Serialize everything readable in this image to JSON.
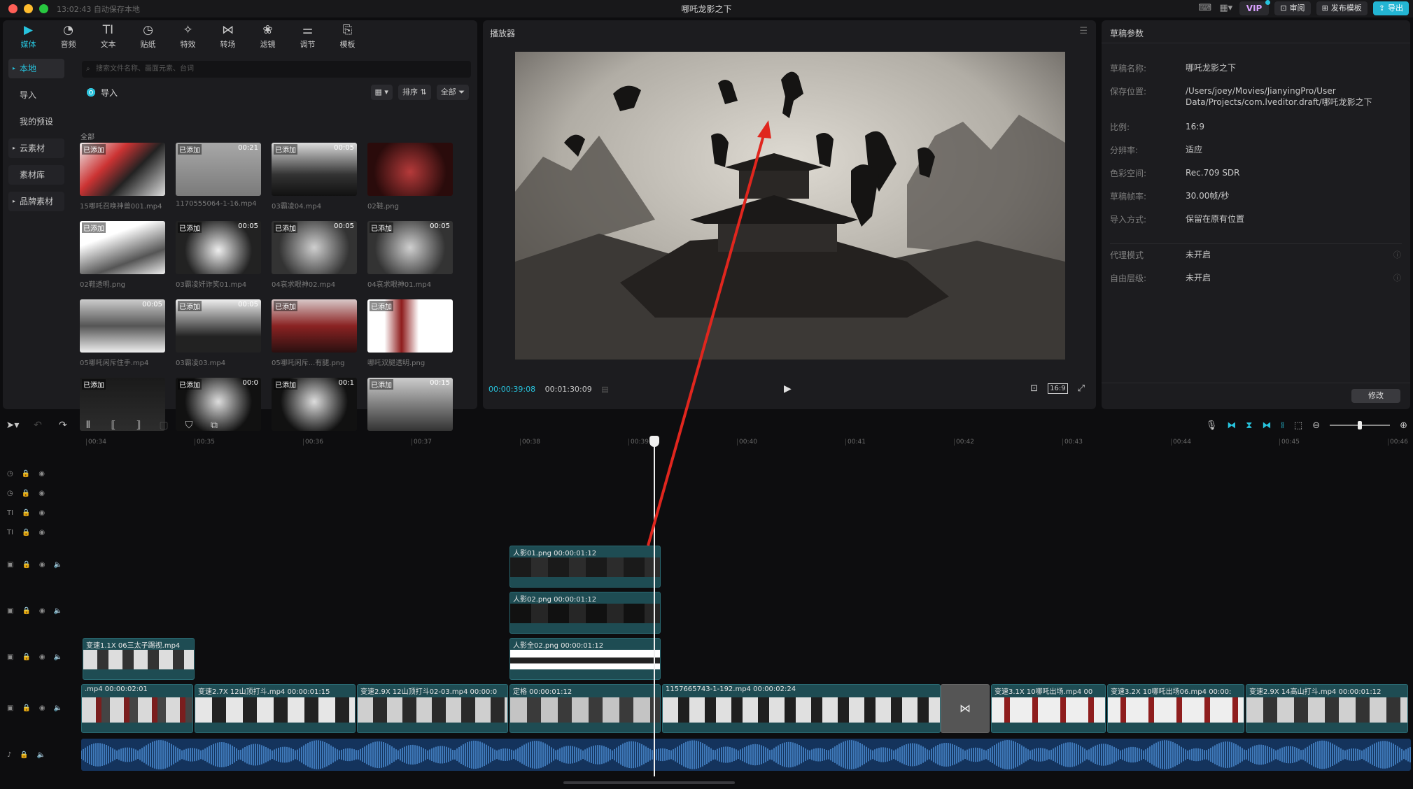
{
  "titlebar": {
    "autosave": "13:02:43 自动保存本地",
    "title": "哪吒龙影之下",
    "vip": "VIP",
    "review": "审阅",
    "publish": "发布模板",
    "export": "导出"
  },
  "tools": [
    {
      "label": "媒体",
      "icon": "media-icon",
      "active": true
    },
    {
      "label": "音频",
      "icon": "audio-icon"
    },
    {
      "label": "文本",
      "icon": "text-icon"
    },
    {
      "label": "贴纸",
      "icon": "sticker-icon"
    },
    {
      "label": "特效",
      "icon": "effects-icon"
    },
    {
      "label": "转场",
      "icon": "transition-icon"
    },
    {
      "label": "滤镜",
      "icon": "filter-icon"
    },
    {
      "label": "调节",
      "icon": "adjust-icon"
    },
    {
      "label": "模板",
      "icon": "template-icon"
    }
  ],
  "sidebar": {
    "items": [
      {
        "label": "本地",
        "active": true,
        "caret": true
      },
      {
        "label": "导入"
      },
      {
        "label": "我的预设"
      },
      {
        "label": "云素材",
        "caret": true,
        "box": true
      },
      {
        "label": "素材库",
        "box": true
      },
      {
        "label": "品牌素材",
        "caret": true,
        "box": true
      }
    ]
  },
  "media": {
    "search_placeholder": "搜索文件名称、画面元素、台词",
    "import_label": "导入",
    "sort_label": "排序",
    "all_filter": "全部",
    "section_label": "全部",
    "items": [
      {
        "name": "15哪吒召唤神兽001.mp4",
        "badge": "已添加",
        "duration": ""
      },
      {
        "name": "1170555064-1-16.mp4",
        "badge": "已添加",
        "duration": "00:21"
      },
      {
        "name": "03霸凌04.mp4",
        "badge": "已添加",
        "duration": "00:05"
      },
      {
        "name": "02鞋.png",
        "badge": "",
        "duration": ""
      },
      {
        "name": "02鞋透明.png",
        "badge": "已添加",
        "duration": ""
      },
      {
        "name": "03霸凌奸诈笑01.mp4",
        "badge": "已添加",
        "duration": "00:05"
      },
      {
        "name": "04哀求眼神02.mp4",
        "badge": "已添加",
        "duration": "00:05"
      },
      {
        "name": "04哀求眼神01.mp4",
        "badge": "已添加",
        "duration": "00:05"
      },
      {
        "name": "05哪吒闲斥住手.mp4",
        "badge": "",
        "duration": "00:05"
      },
      {
        "name": "03霸凌03.mp4",
        "badge": "已添加",
        "duration": "00:05"
      },
      {
        "name": "05哪吒闲斥...有腿.png",
        "badge": "已添加",
        "duration": ""
      },
      {
        "name": "哪吒双腿透明.png",
        "badge": "已添加",
        "duration": ""
      },
      {
        "name": "",
        "badge": "已添加",
        "duration": ""
      },
      {
        "name": "",
        "badge": "已添加",
        "duration": "00:0"
      },
      {
        "name": "",
        "badge": "已添加",
        "duration": "00:1"
      },
      {
        "name": "",
        "badge": "已添加",
        "duration": "00:15"
      }
    ]
  },
  "player": {
    "title": "播放器",
    "current_time": "00:00:39:08",
    "total_time": "00:01:30:09",
    "ratio": "16:9"
  },
  "properties": {
    "title": "草稿参数",
    "rows": [
      {
        "key": "草稿名称:",
        "value": "哪吒龙影之下"
      },
      {
        "key": "保存位置:",
        "value": "/Users/joey/Movies/JianyingPro/User Data/Projects/com.lveditor.draft/哪吒龙影之下"
      },
      {
        "key": "比例:",
        "value": "16:9"
      },
      {
        "key": "分辨率:",
        "value": "适应"
      },
      {
        "key": "色彩空间:",
        "value": "Rec.709 SDR"
      },
      {
        "key": "草稿帧率:",
        "value": "30.00帧/秒"
      },
      {
        "key": "导入方式:",
        "value": "保留在原有位置"
      },
      {
        "key": "代理模式",
        "value": "未开启"
      },
      {
        "key": "自由层级:",
        "value": "未开启"
      }
    ],
    "modify": "修改"
  },
  "timeline": {
    "ruler": [
      "00:34",
      "00:35",
      "00:36",
      "00:37",
      "00:38",
      "00:39",
      "00:40",
      "00:41",
      "00:42",
      "00:43",
      "00:44",
      "00:45",
      "00:46"
    ],
    "overlay_clips": [
      {
        "label": "人影01.png  00:00:01:12"
      },
      {
        "label": "人影02.png  00:00:01:12"
      },
      {
        "label": "人影全02.png  00:00:01:12"
      },
      {
        "label": "变速1.1X  06三太子踢视.mp4"
      }
    ],
    "main_clips": [
      {
        "label": ".mp4  00:00:02:01"
      },
      {
        "label": "变速2.7X  12山顶打斗.mp4  00:00:01:15"
      },
      {
        "label": "变速2.9X  12山顶打斗02-03.mp4  00:00:0"
      },
      {
        "label": "定格  00:00:01:12"
      },
      {
        "label": "1157665743-1-192.mp4  00:00:02:24"
      },
      {
        "label": "变速3.1X  10哪吒出场.mp4  00"
      },
      {
        "label": "变速3.2X  10哪吒出场06.mp4  00:00:"
      },
      {
        "label": "变速2.9X  14高山打斗.mp4  00:00:01:12"
      }
    ]
  },
  "colors": {
    "accent": "#27c3dd",
    "clip": "#1e4c53",
    "audio": "#14335c",
    "arrow": "#e0261e"
  }
}
